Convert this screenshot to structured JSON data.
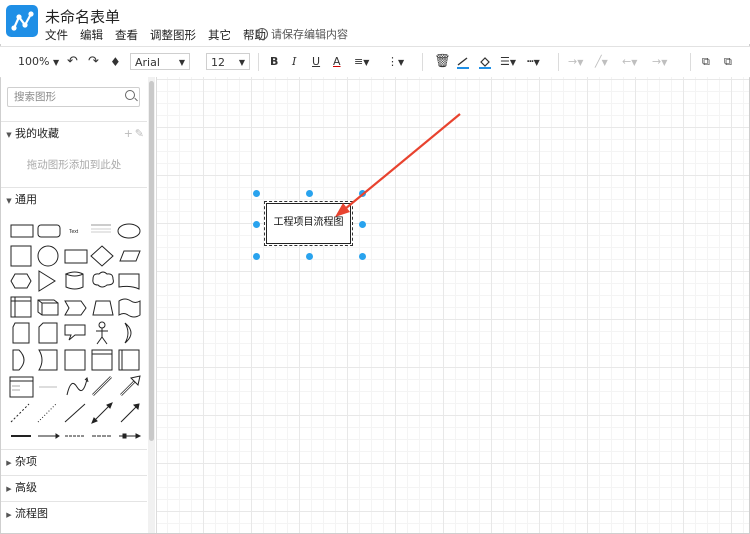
{
  "app": {
    "title": "未命名表单"
  },
  "menu": [
    "文件",
    "编辑",
    "查看",
    "调整图形",
    "其它",
    "帮助"
  ],
  "save_warning": "请保存编辑内容",
  "toolbar": {
    "zoom": "100%",
    "font": "Arial",
    "font_size": "12"
  },
  "sidebar": {
    "search_placeholder": "搜索图形",
    "favorites": {
      "label": "我的收藏",
      "hint": "拖动图形添加到此处"
    },
    "general": {
      "label": "通用"
    },
    "sections": [
      "杂项",
      "高级",
      "流程图"
    ]
  },
  "canvas": {
    "node_label": "工程项目流程图"
  },
  "colors": {
    "accent": "#29a3ee",
    "arrow": "#e8432f",
    "logo": "#1f8fe6"
  }
}
